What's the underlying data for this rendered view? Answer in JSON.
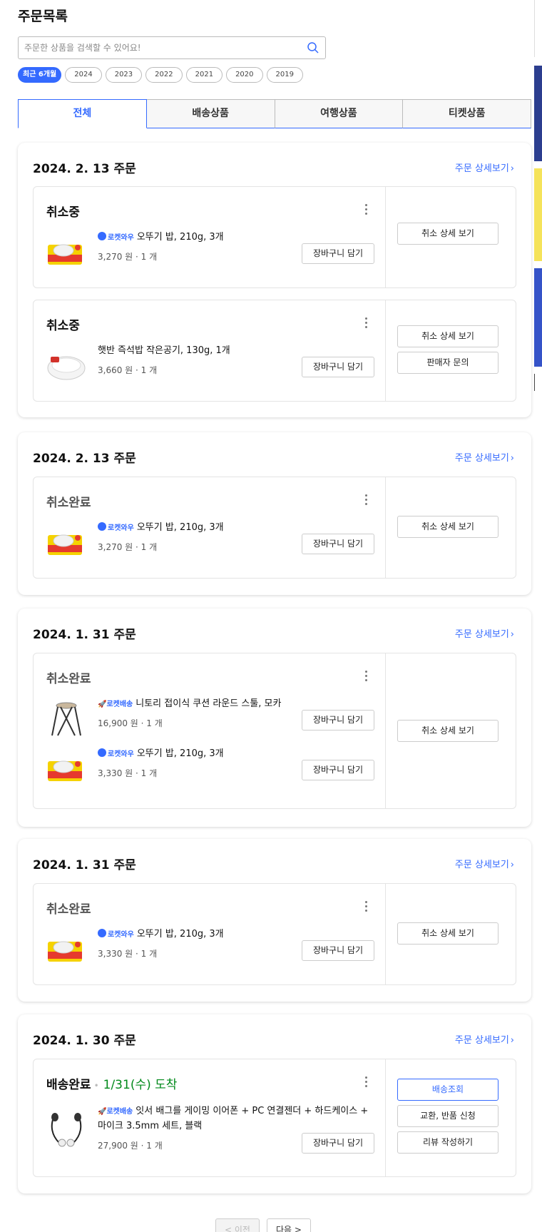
{
  "page_title": "주문목록",
  "search": {
    "placeholder": "주문한 상품을 검색할 수 있어요!",
    "value": ""
  },
  "year_filters": [
    "최근 6개월",
    "2024",
    "2023",
    "2022",
    "2021",
    "2020",
    "2019"
  ],
  "tabs": [
    "전체",
    "배송상품",
    "여행상품",
    "티켓상품"
  ],
  "detail_label": "주문 상세보기",
  "cart_label": "장바구니 담기",
  "orders": [
    {
      "date": "2024. 2. 13 주문",
      "bundles": [
        {
          "status": "취소중",
          "items": [
            {
              "badge": "로켓와우",
              "name": "오뚜기 밥, 210g, 3개",
              "price": "3,270 원 · 1 개"
            }
          ],
          "actions": [
            "취소 상세 보기"
          ]
        },
        {
          "status": "취소중",
          "items": [
            {
              "badge": "",
              "name": "햇반 즉석밥 작은공기, 130g, 1개",
              "price": "3,660 원 · 1 개"
            }
          ],
          "actions": [
            "취소 상세 보기",
            "판매자 문의"
          ]
        }
      ]
    },
    {
      "date": "2024. 2. 13 주문",
      "bundles": [
        {
          "status": "취소완료",
          "items": [
            {
              "badge": "로켓와우",
              "name": "오뚜기 밥, 210g, 3개",
              "price": "3,270 원 · 1 개"
            }
          ],
          "actions": [
            "취소 상세 보기"
          ]
        }
      ]
    },
    {
      "date": "2024. 1. 31 주문",
      "bundles": [
        {
          "status": "취소완료",
          "items": [
            {
              "badge": "로켓배송",
              "name": "니토리 접이식 쿠션 라운드 스툴, 모카",
              "price": "16,900 원 · 1 개"
            },
            {
              "badge": "로켓와우",
              "name": "오뚜기 밥, 210g, 3개",
              "price": "3,330 원 · 1 개"
            }
          ],
          "actions": [
            "취소 상세 보기"
          ]
        }
      ]
    },
    {
      "date": "2024. 1. 31 주문",
      "bundles": [
        {
          "status": "취소완료",
          "items": [
            {
              "badge": "로켓와우",
              "name": "오뚜기 밥, 210g, 3개",
              "price": "3,330 원 · 1 개"
            }
          ],
          "actions": [
            "취소 상세 보기"
          ]
        }
      ]
    },
    {
      "date": "2024. 1. 30 주문",
      "bundles": [
        {
          "status": "배송완료",
          "arrival": "1/31(수) 도착",
          "items": [
            {
              "badge": "로켓배송",
              "name": "잇서 배그를 게이밍 이어폰 + PC 연결젠더 + 하드케이스 + 마이크 3.5mm 세트, 블랙",
              "price": "27,900 원 · 1 개"
            }
          ],
          "actions": [
            "배송조회",
            "교환, 반품 신청",
            "리뷰 작성하기"
          ]
        }
      ]
    }
  ],
  "pager": {
    "prev": "< 이전",
    "next": "다음 >"
  },
  "colors": {
    "accent": "#346aff",
    "arrival": "#00891a"
  }
}
